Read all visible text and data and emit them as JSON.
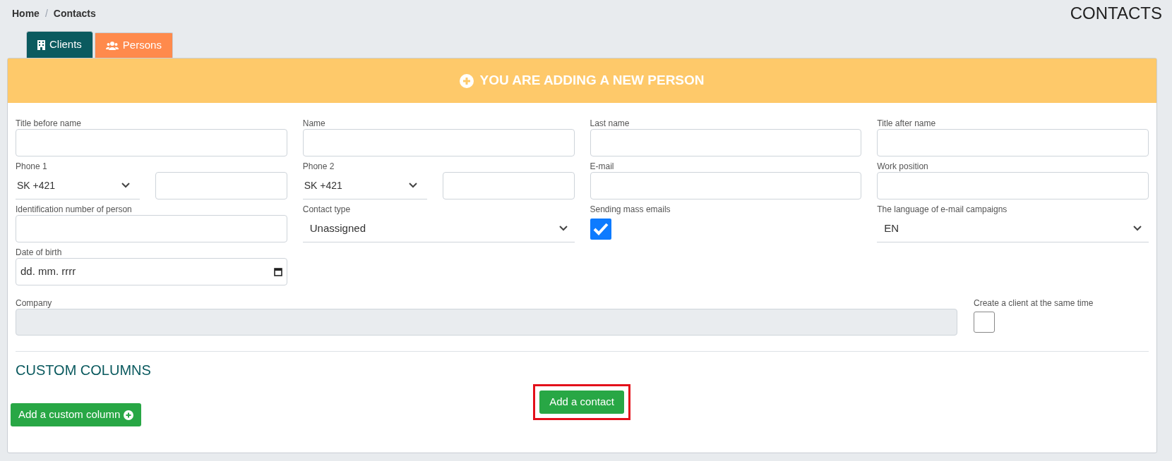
{
  "breadcrumb": {
    "items": [
      {
        "label": "Home"
      },
      {
        "label": "Contacts"
      }
    ],
    "separator": "/"
  },
  "page_title": "CONTACTS",
  "tabs": [
    {
      "label": "Clients",
      "selected": true,
      "color": "#0b5a5f"
    },
    {
      "label": "Persons",
      "selected": false,
      "color": "#ff8a4c"
    }
  ],
  "form_header": {
    "title": "YOU ARE ADDING A NEW PERSON"
  },
  "fields": [
    {
      "kind": "text",
      "label": "Title before name"
    },
    {
      "kind": "text",
      "label": "Name"
    },
    {
      "kind": "text",
      "label": "Last name"
    },
    {
      "kind": "text",
      "label": "Title after name"
    },
    {
      "kind": "phone",
      "label": "Phone 1",
      "prefix": "SK +421"
    },
    {
      "kind": "phone",
      "label": "Phone 2",
      "prefix": "SK +421"
    },
    {
      "kind": "text",
      "label": "E-mail"
    },
    {
      "kind": "text",
      "label": "Work position"
    },
    {
      "kind": "text",
      "label": "Identification number of person"
    },
    {
      "kind": "select",
      "label": "Contact type",
      "value": "Unassigned"
    },
    {
      "kind": "checkbox",
      "label": "Sending mass emails",
      "checked": true
    },
    {
      "kind": "select",
      "label": "The language of e-mail campaigns",
      "value": "EN"
    },
    {
      "kind": "date",
      "label": "Date of birth",
      "placeholder": "dd. mm. rrrr"
    }
  ],
  "company": {
    "label": "Company",
    "disabled": true
  },
  "create_client": {
    "label": "Create a client at the same time",
    "checked": false
  },
  "custom_columns": {
    "heading": "CUSTOM COLUMNS",
    "button": "Add a custom column"
  },
  "submit_button": {
    "label": "Add a contact",
    "highlighted": true
  }
}
